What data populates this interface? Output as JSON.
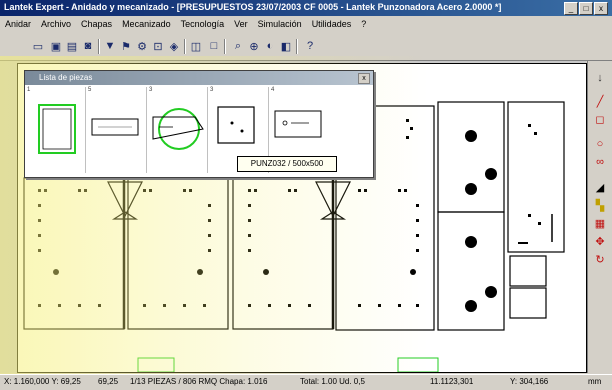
{
  "window": {
    "title": "Lantek Expert - Anidado y mecanizado - [PRESUPUESTOS 23/07/2003 CF 0005 - Lantek Punzonadora Acero 2.0000 *]",
    "controls": [
      "_",
      "□",
      "x"
    ]
  },
  "menu": [
    "Anidar",
    "Archivo",
    "Chapas",
    "Mecanizado",
    "Tecnología",
    "Ver",
    "Simulación",
    "Utilidades",
    "?"
  ],
  "palette": {
    "title": "Lista de piezas",
    "close_label": "x",
    "items": [
      {
        "num": "1"
      },
      {
        "num": "5"
      },
      {
        "num": "3"
      },
      {
        "num": "3"
      },
      {
        "num": "4"
      }
    ]
  },
  "tooltip": "PUNZ032 / 500x500",
  "status": {
    "coords": "X: 1.160,000   Y: 69,25",
    "value2": "69,25",
    "info": "1/13  PIEZAS / 806 RMQ   Chapa: 1.016",
    "total": "Total: 1.00 Ud. 0,5",
    "field1": "11.1123,301",
    "field2": "Y: 304,166",
    "field3": "mm"
  },
  "colors": {
    "title_bar": "#0a246a",
    "tint": "#f6f078",
    "green_circle": "#22cc22",
    "chrome": "#d4d0c8"
  }
}
